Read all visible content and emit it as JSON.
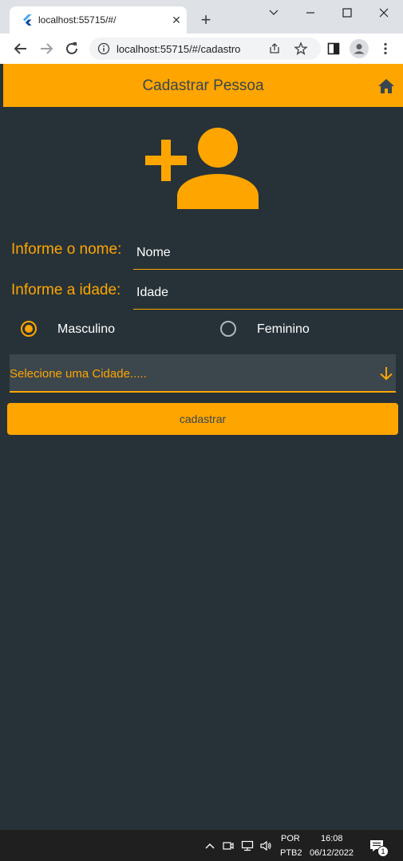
{
  "browser": {
    "tab_title": "localhost:55715/#/",
    "tab_close": "✕",
    "new_tab": "+",
    "url": "localhost:55715/#/cadastro",
    "window_controls": [
      "minimize-icon",
      "maximize-icon",
      "close-icon"
    ]
  },
  "app": {
    "title": "Cadastrar Pessoa",
    "accent_color": "#ffa500",
    "background_color": "#263238",
    "header_icon": "home-icon",
    "hero_icon": "person-add-icon",
    "fields": [
      {
        "label": "Informe o nome:",
        "placeholder": "Nome"
      },
      {
        "label": "Informe a idade:",
        "placeholder": "Idade"
      }
    ],
    "gender": {
      "options": [
        "Masculino",
        "Feminino"
      ],
      "selected": "Masculino"
    },
    "city": {
      "hint": "Selecione uma Cidade.....",
      "icon": "arrow-down-icon"
    },
    "submit_label": "cadastrar"
  },
  "taskbar": {
    "language": "POR",
    "layout": "PTB2",
    "time": "16:08",
    "date": "06/12/2022",
    "notifications": "1"
  }
}
